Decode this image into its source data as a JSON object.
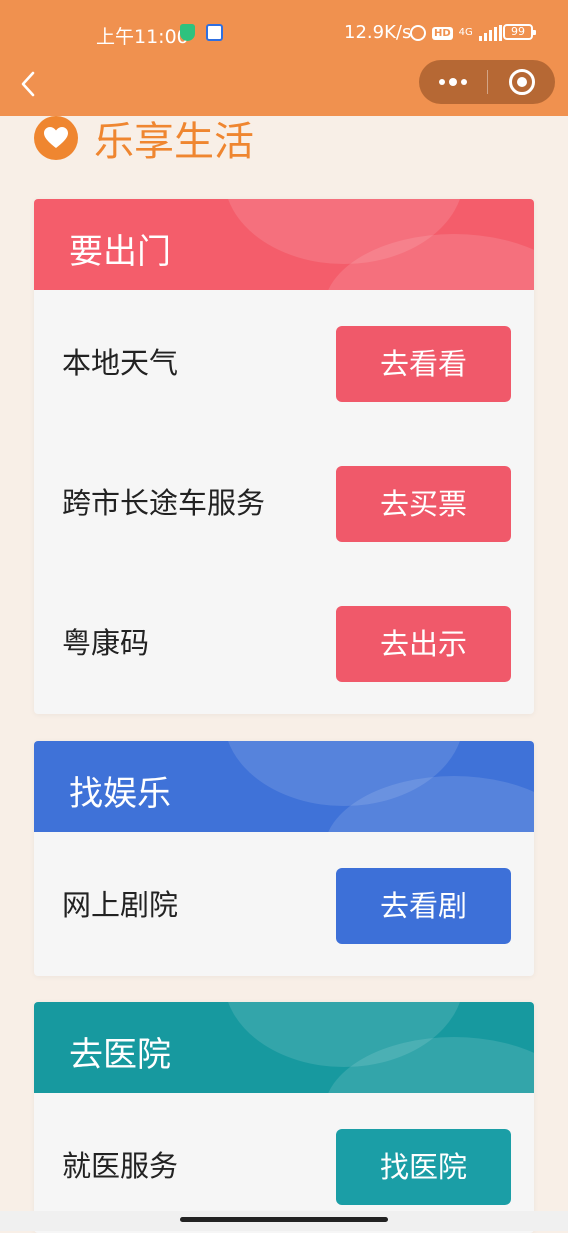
{
  "status_bar": {
    "time": "上午11:00",
    "net_speed": "12.9K/s",
    "hd_badge": "HD",
    "network_type": "4G",
    "battery": "99"
  },
  "nav": {
    "back_icon": "chevron-left-icon"
  },
  "header": {
    "title": "乐享生活",
    "icon": "heart-icon"
  },
  "colors": {
    "accent": "#f0914f",
    "red": "#f45d6b",
    "blue": "#3f72d8",
    "teal": "#17999f"
  },
  "sections": [
    {
      "title": "要出门",
      "items": [
        {
          "label": "本地天气",
          "button": "去看看"
        },
        {
          "label": "跨市长途车服务",
          "button": "去买票"
        },
        {
          "label": "粤康码",
          "button": "去出示"
        }
      ]
    },
    {
      "title": "找娱乐",
      "items": [
        {
          "label": "网上剧院",
          "button": "去看剧"
        }
      ]
    },
    {
      "title": "去医院",
      "items": [
        {
          "label": "就医服务",
          "button": "找医院"
        }
      ]
    }
  ]
}
